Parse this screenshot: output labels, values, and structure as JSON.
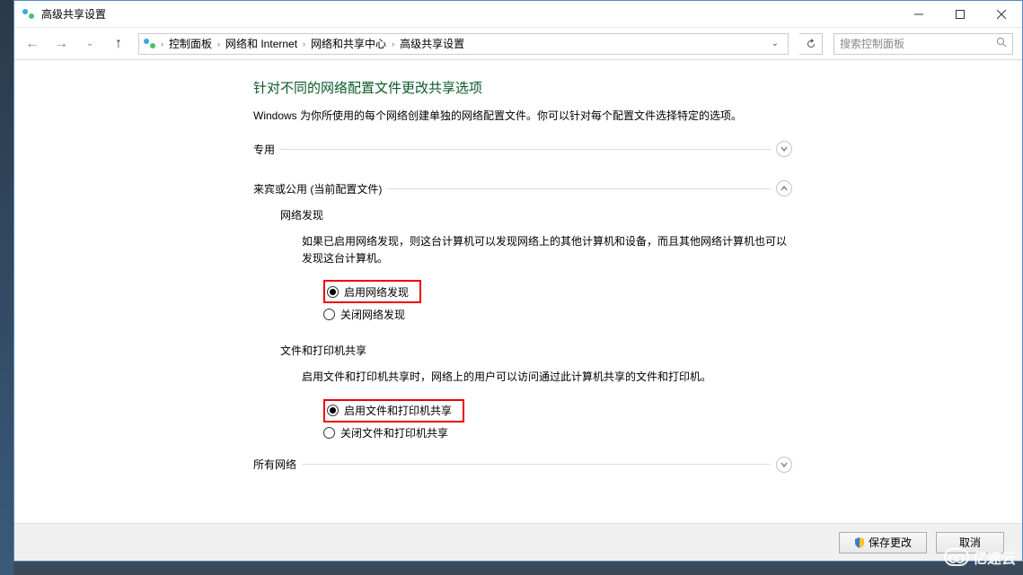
{
  "window": {
    "title": "高级共享设置"
  },
  "breadcrumbs": {
    "items": [
      "控制面板",
      "网络和 Internet",
      "网络和共享中心",
      "高级共享设置"
    ]
  },
  "search": {
    "placeholder": "搜索控制面板"
  },
  "page": {
    "title": "针对不同的网络配置文件更改共享选项",
    "subtitle": "Windows 为你所使用的每个网络创建单独的网络配置文件。你可以针对每个配置文件选择特定的选项。"
  },
  "sections": {
    "private": {
      "label": "专用"
    },
    "guest": {
      "label": "来宾或公用 (当前配置文件)",
      "network_discovery": {
        "label": "网络发现",
        "desc": "如果已启用网络发现，则这台计算机可以发现网络上的其他计算机和设备，而且其他网络计算机也可以发现这台计算机。",
        "opt_enable": "启用网络发现",
        "opt_disable": "关闭网络发现"
      },
      "file_share": {
        "label": "文件和打印机共享",
        "desc": "启用文件和打印机共享时，网络上的用户可以访问通过此计算机共享的文件和打印机。",
        "opt_enable": "启用文件和打印机共享",
        "opt_disable": "关闭文件和打印机共享"
      }
    },
    "all": {
      "label": "所有网络"
    }
  },
  "footer": {
    "save": "保存更改",
    "cancel": "取消"
  },
  "watermark": {
    "text": "亿速云"
  }
}
